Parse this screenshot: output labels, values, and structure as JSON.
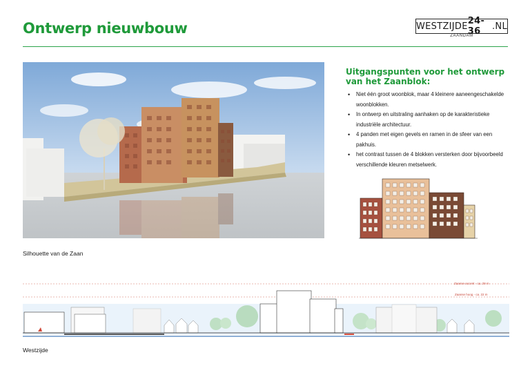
{
  "header": {
    "title": "Ontwerp nieuwbouw",
    "logo_prefix": "WESTZIJDE ",
    "logo_number": "24-36",
    "logo_suffix": ".NL",
    "logo_city": "ZAANDAM"
  },
  "design": {
    "heading": "Uitgangspunten voor het ontwerp van het Zaanblok:",
    "points": [
      "Niet één groot woonblok, maar 4 kleinere aaneengeschakelde woonblokken.",
      "In ontwerp en uitstraling aanhaken op de karakteristieke industriële architectuur.",
      "4 panden met eigen gevels en ramen in de sfeer van een pakhuis.",
      "het contrast tussen de 4 blokken versterken door bijvoorbeeld verschillende kleuren metselwerk."
    ]
  },
  "silhouette": {
    "caption": "Silhouette van de Zaan",
    "marker_accent": "Zaanse accent - ca. 29 m",
    "marker_hoog": "Zaanse hoog - ca. 22 m",
    "bottom_caption": "Westzijde"
  },
  "colors": {
    "accent_green": "#1f9a3a",
    "brick_red": "#a6513f",
    "brick_tan": "#d7a27a",
    "brick_brown": "#7a4a35",
    "marker_red": "#c8483a"
  }
}
